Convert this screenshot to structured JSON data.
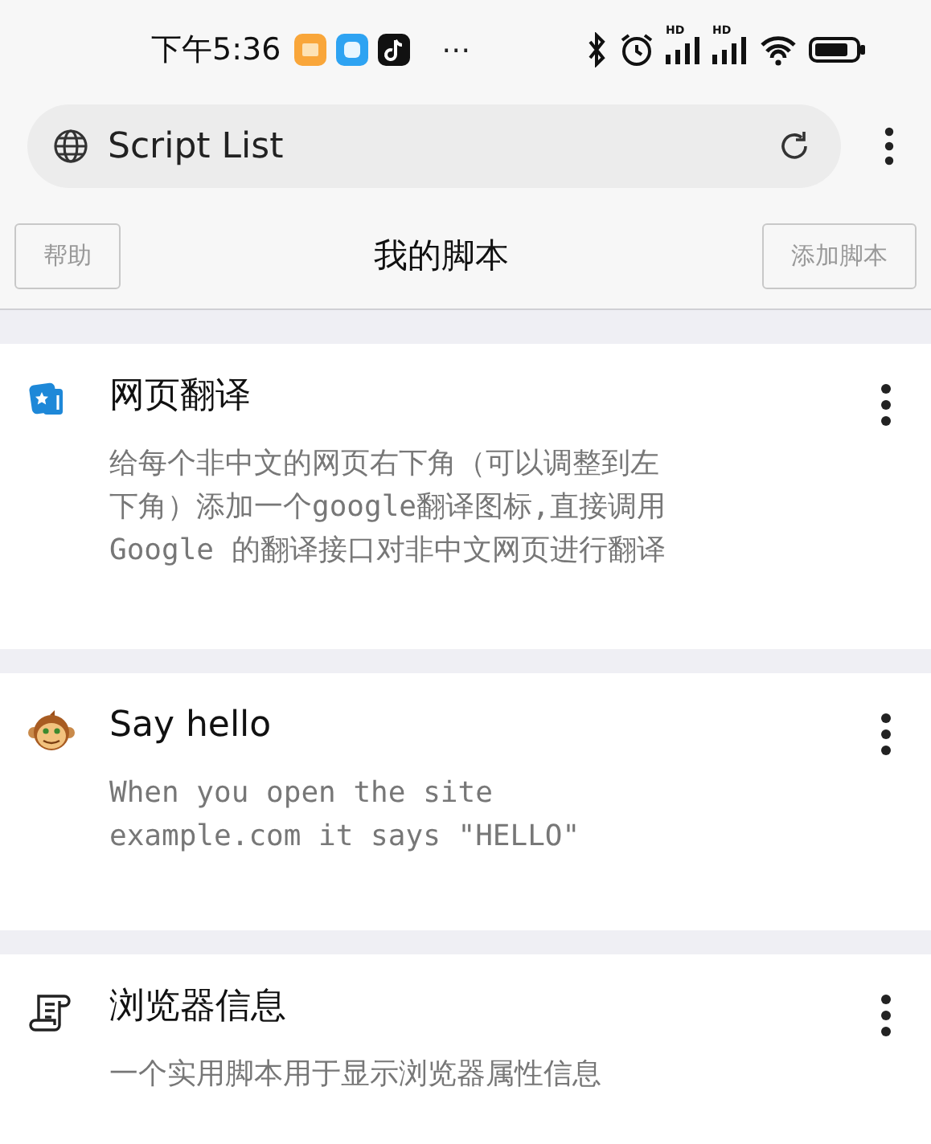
{
  "status_bar": {
    "time": "下午5:36",
    "more": "⋯",
    "signals": [
      {
        "label": "HD"
      },
      {
        "label": "HD"
      }
    ]
  },
  "address_bar": {
    "title": "Script List"
  },
  "header": {
    "left_button": "帮助",
    "title": "我的脚本",
    "right_button": "添加脚本"
  },
  "scripts": [
    {
      "kind": "translate",
      "name": "网页翻译",
      "description_lines": [
        "给每个非中文的网页右下角（可以调整到左",
        "下角）添加一个google翻译图标,直接调用",
        "Google 的翻译接口对非中文网页进行翻译"
      ]
    },
    {
      "kind": "monkey",
      "name": "Say hello",
      "description_lines": [
        "When you open the site",
        "example.com it says \"HELLO\""
      ]
    },
    {
      "kind": "scroll",
      "name": "浏览器信息",
      "description_lines": [
        "一个实用脚本用于显示浏览器属性信息"
      ]
    }
  ]
}
